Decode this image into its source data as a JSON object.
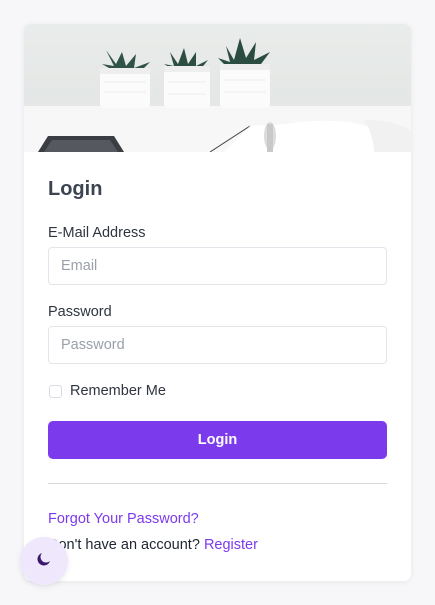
{
  "login": {
    "title": "Login",
    "email_label": "E-Mail Address",
    "email_placeholder": "Email",
    "email_value": "",
    "password_label": "Password",
    "password_placeholder": "Password",
    "password_value": "",
    "remember_label": "Remember Me",
    "remember_checked": false,
    "submit_label": "Login",
    "forgot_link": "Forgot Your Password?",
    "no_account_text": "Don't have an account?",
    "register_link": "Register"
  },
  "theme_toggle": {
    "icon": "moon-icon"
  },
  "colors": {
    "accent": "#7c3aed",
    "background": "#f7f7f9",
    "card": "#ffffff",
    "theme_button_bg": "#efe8fd",
    "moon": "#3b1a6e"
  }
}
